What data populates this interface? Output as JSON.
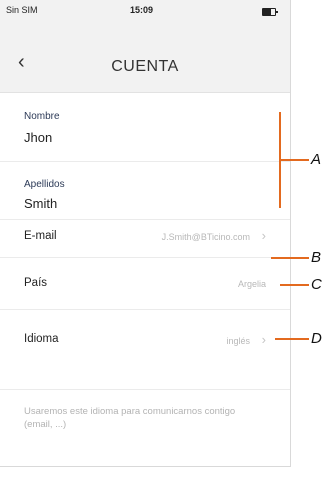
{
  "status": {
    "carrier": "Sin SIM",
    "time": "15:09"
  },
  "nav": {
    "title": "CUENTA"
  },
  "profile": {
    "first_name_label": "Nombre",
    "first_name_value": "Jhon",
    "last_name_label": "Apellidos",
    "last_name_value": "Smith"
  },
  "rows": {
    "email_label": "E-mail",
    "email_value": "J.Smith@BTicino.com",
    "country_label": "País",
    "country_value": "Argelia",
    "language_label": "Idioma",
    "language_value": "inglés"
  },
  "hint": "Usaremos este idioma para comunicarnos contigo (email, ...)",
  "callouts": {
    "a": "A",
    "b": "B",
    "c": "C",
    "d": "D"
  },
  "accent_color": "#e36a1f"
}
